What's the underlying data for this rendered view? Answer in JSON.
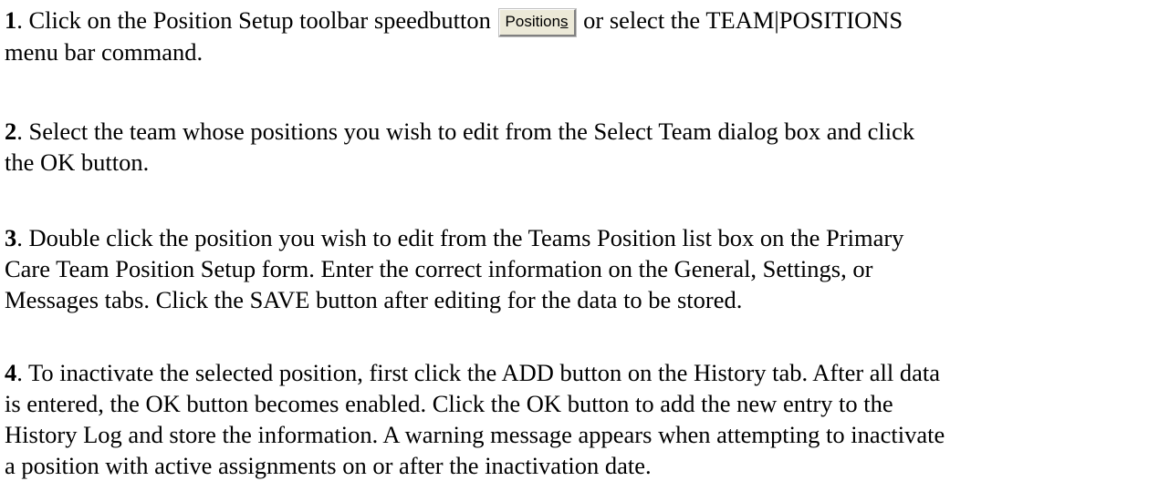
{
  "steps": [
    {
      "number": "1",
      "lines": [
        {
          "before": ". Click on the Position Setup toolbar speedbutton ",
          "after": " or select the TEAM|POSITIONS"
        },
        "menu bar command."
      ]
    },
    {
      "number": "2",
      "lines": [
        ". Select the team whose positions you wish to edit from the Select Team dialog box and click",
        "the OK button."
      ]
    },
    {
      "number": "3",
      "lines": [
        ". Double click the position you wish to edit from the Teams Position list box on the Primary",
        "Care Team Position Setup form. Enter the correct information on the General, Settings, or",
        "Messages tabs. Click the SAVE button after editing for the data to be stored."
      ]
    },
    {
      "number": "4",
      "lines": [
        ". To inactivate the selected position, first click the ADD button on the History tab. After all data",
        "is entered, the OK button becomes enabled. Click the OK button to add the new entry to the",
        "History Log and store the information. A warning message appears when attempting to inactivate",
        "a position with active assignments on or after the inactivation date."
      ]
    }
  ],
  "positions_button": {
    "label_main": "Position",
    "label_underlined": "s"
  }
}
